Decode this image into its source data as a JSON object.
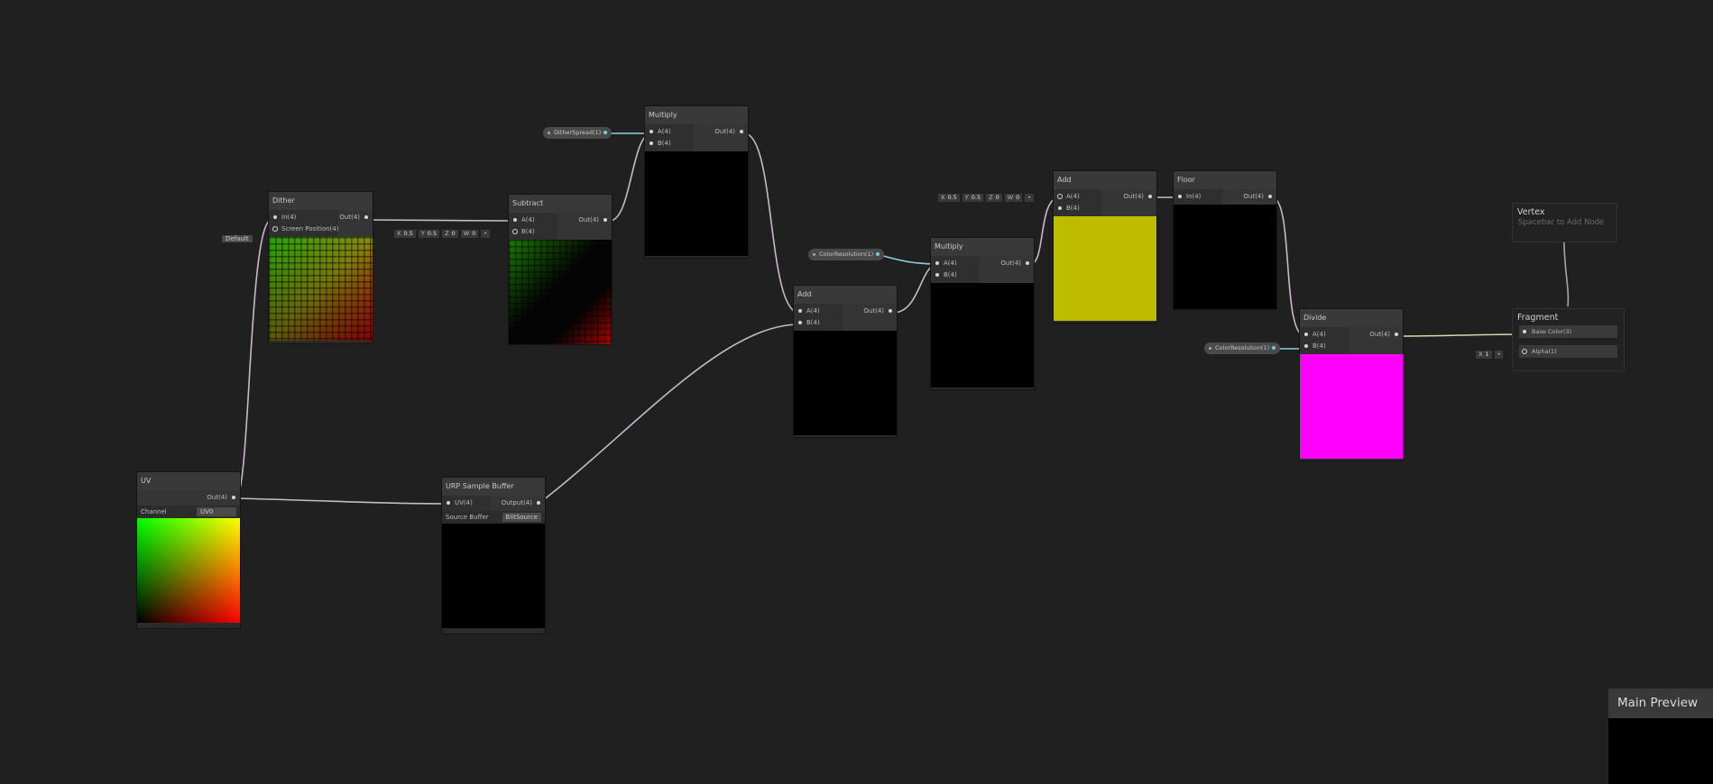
{
  "nodes": {
    "dither": {
      "title": "Dither",
      "in_port": "In(4)",
      "screen_port": "Screen Position(4)",
      "out_port": "Out(4)",
      "screen_dropdown": "Default"
    },
    "subtract": {
      "title": "Subtract",
      "a_port": "A(4)",
      "b_port": "B(4)",
      "out_port": "Out(4)"
    },
    "multiply1": {
      "title": "Multiply",
      "a_port": "A(4)",
      "b_port": "B(4)",
      "out_port": "Out(4)"
    },
    "uv": {
      "title": "UV",
      "out_port": "Out(4)",
      "channel_label": "Channel",
      "channel_value": "UV0"
    },
    "urp": {
      "title": "URP Sample Buffer",
      "uv_port": "UV(4)",
      "out_port": "Output(4)",
      "source_label": "Source Buffer",
      "source_value": "BlitSource"
    },
    "add1": {
      "title": "Add",
      "a_port": "A(4)",
      "b_port": "B(4)",
      "out_port": "Out(4)"
    },
    "multiply2": {
      "title": "Multiply",
      "a_port": "A(4)",
      "b_port": "B(4)",
      "out_port": "Out(4)"
    },
    "add2": {
      "title": "Add",
      "a_port": "A(4)",
      "b_port": "B(4)",
      "out_port": "Out(4)"
    },
    "floor": {
      "title": "Floor",
      "in_port": "In(4)",
      "out_port": "Out(4)"
    },
    "divide": {
      "title": "Divide",
      "a_port": "A(4)",
      "b_port": "B(4)",
      "out_port": "Out(4)"
    }
  },
  "properties": {
    "dither_spread": "DitherSpread(1)",
    "color_resolution_a": "ColorResolution(1)",
    "color_resolution_b": "ColorResolution(1)"
  },
  "vectors": {
    "subtract_b": {
      "x": "0.5",
      "y": "0.5",
      "z": "0",
      "w": "0"
    },
    "add2_b": {
      "x": "0.5",
      "y": "0.5",
      "z": "0",
      "w": "0"
    },
    "alpha": {
      "x": "1"
    }
  },
  "vector_labels": {
    "x": "X",
    "y": "Y",
    "z": "Z",
    "w": "W"
  },
  "vertex": {
    "title": "Vertex",
    "hint": "Spacebar to Add Node"
  },
  "fragment": {
    "title": "Fragment",
    "base_color": "Base Color(3)",
    "alpha": "Alpha(1)"
  },
  "main_preview": {
    "title": "Main Preview"
  },
  "colors": {
    "wire": "#c9b8cc",
    "property_wire": "#8fd0dd",
    "yellow_preview": "#bdbc00",
    "magenta_preview": "#ff00ff",
    "canvas": "#202020"
  }
}
